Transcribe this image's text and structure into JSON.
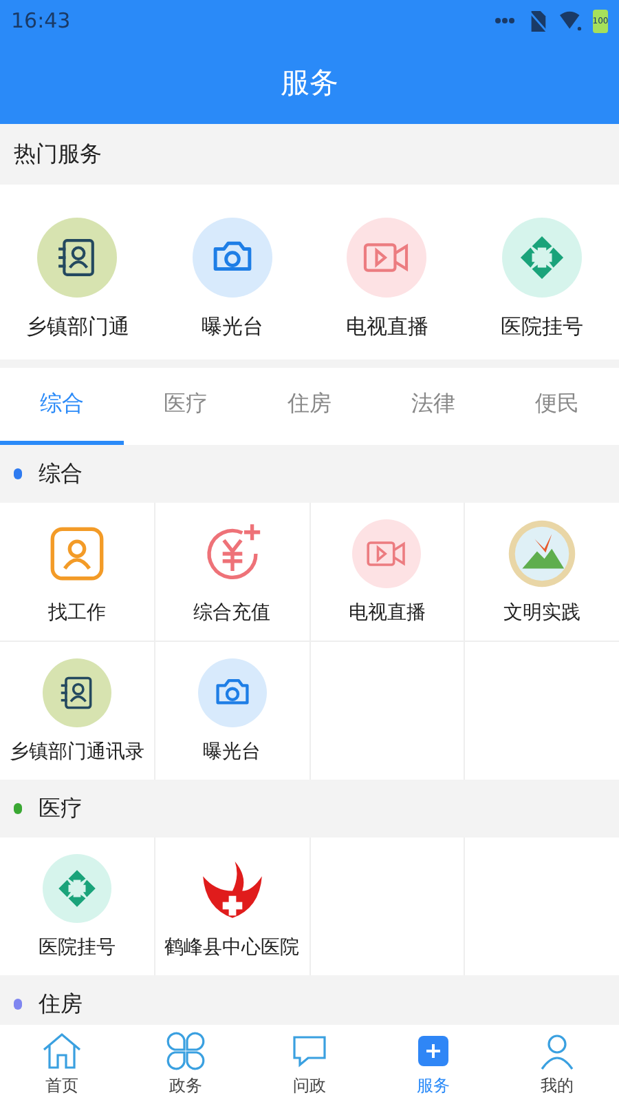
{
  "status_bar": {
    "time": "16:43",
    "battery": "100"
  },
  "header": {
    "title": "服务"
  },
  "hot_services": {
    "title": "热门服务",
    "items": [
      {
        "label": "乡镇部门通",
        "kind": "contacts"
      },
      {
        "label": "曝光台",
        "kind": "camera"
      },
      {
        "label": "电视直播",
        "kind": "video"
      },
      {
        "label": "医院挂号",
        "kind": "hospital"
      }
    ]
  },
  "tabs": [
    {
      "label": "综合",
      "selected": true
    },
    {
      "label": "医疗",
      "selected": false
    },
    {
      "label": "住房",
      "selected": false
    },
    {
      "label": "法律",
      "selected": false
    },
    {
      "label": "便民",
      "selected": false
    }
  ],
  "sections": [
    {
      "title": "综合",
      "color": "#2f7bf0",
      "items": [
        {
          "label": "找工作",
          "kind": "job"
        },
        {
          "label": "综合充值",
          "kind": "recharge"
        },
        {
          "label": "电视直播",
          "kind": "video"
        },
        {
          "label": "文明实践",
          "kind": "emblem"
        },
        {
          "label": "乡镇部门通讯录",
          "kind": "contacts"
        },
        {
          "label": "曝光台",
          "kind": "camera"
        }
      ]
    },
    {
      "title": "医疗",
      "color": "#3aa833",
      "items": [
        {
          "label": "医院挂号",
          "kind": "hospital"
        },
        {
          "label": "鹤峰县中心医院",
          "kind": "crane"
        }
      ]
    },
    {
      "title": "住房",
      "color": "#7f86f0"
    }
  ],
  "bottom_nav": [
    {
      "label": "首页",
      "kind": "home",
      "selected": false
    },
    {
      "label": "政务",
      "kind": "grid",
      "selected": false
    },
    {
      "label": "问政",
      "kind": "chat",
      "selected": false
    },
    {
      "label": "服务",
      "kind": "service",
      "selected": true
    },
    {
      "label": "我的",
      "kind": "user",
      "selected": false
    }
  ]
}
